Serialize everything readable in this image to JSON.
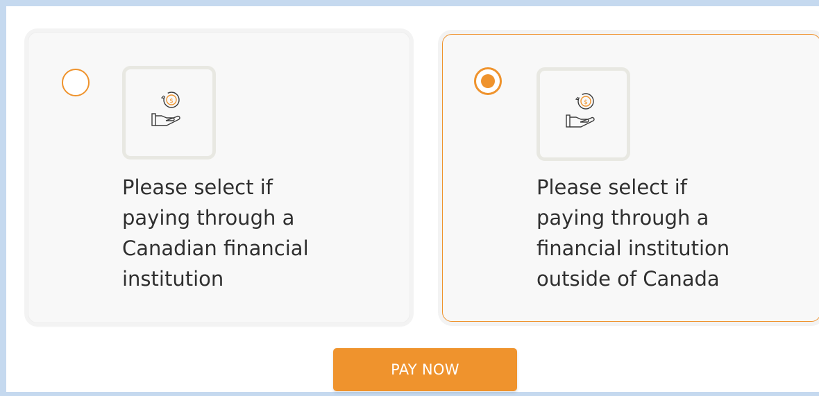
{
  "colors": {
    "accent": "#ef932d",
    "text": "#2f2f2f",
    "card_background": "#f8f8f8",
    "frame": "#c5d9ef"
  },
  "options": [
    {
      "label_lines": [
        "Please select if",
        "paying through a",
        "Canadian financial",
        "institution"
      ],
      "selected": false,
      "icon": "hand-coin-icon"
    },
    {
      "label_lines": [
        "Please select if",
        "paying through a",
        "financial institution",
        "outside of Canada"
      ],
      "selected": true,
      "icon": "hand-coin-icon"
    }
  ],
  "pay_button": {
    "label": "PAY NOW"
  }
}
